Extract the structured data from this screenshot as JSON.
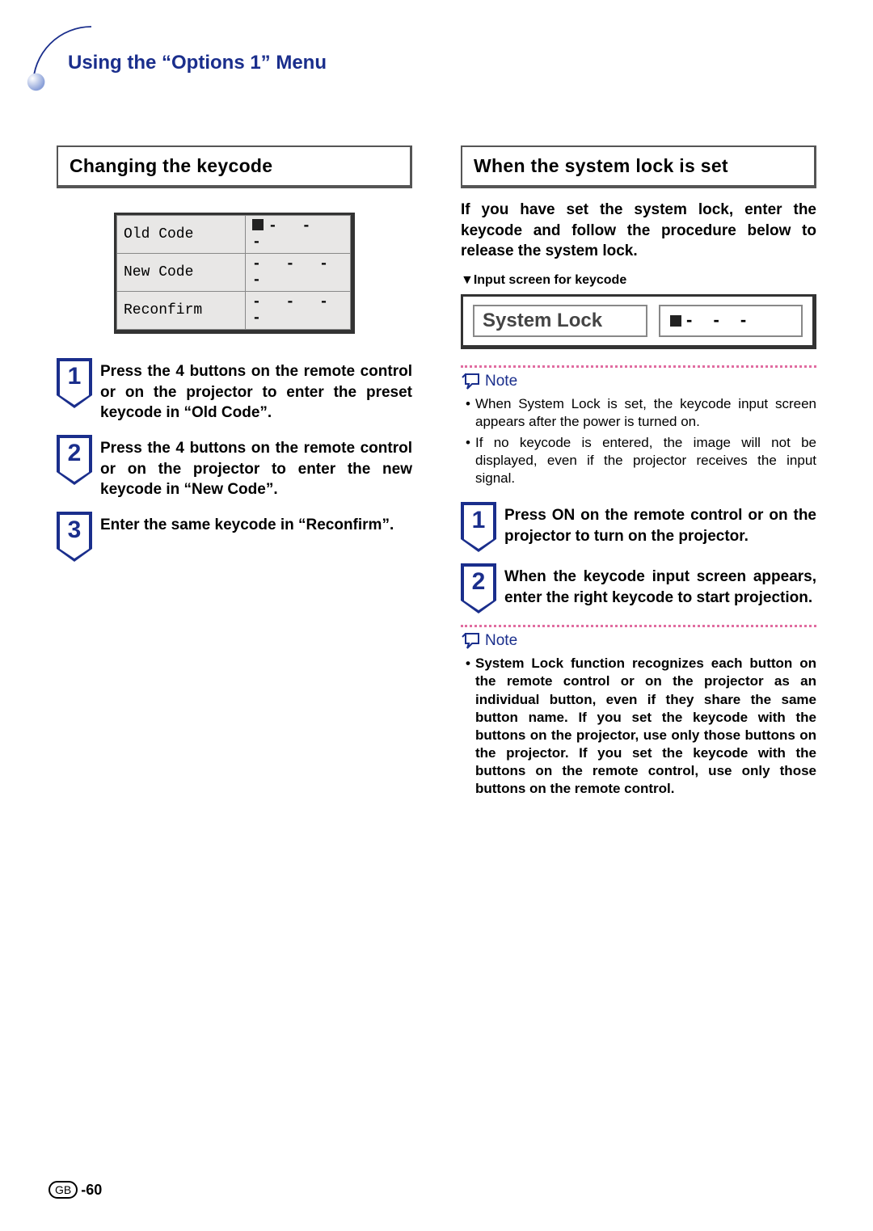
{
  "page_title": "Using the “Options 1” Menu",
  "left": {
    "heading": "Changing the keycode",
    "table": {
      "rows": [
        {
          "label": "Old Code",
          "has_cursor": true
        },
        {
          "label": "New Code",
          "has_cursor": false
        },
        {
          "label": "Reconfirm",
          "has_cursor": false
        }
      ],
      "dash": "- - -",
      "dash4": "- - - -"
    },
    "steps": [
      "Press the 4 buttons on the remote control or on the projector to enter the preset keycode in “Old Code”.",
      "Press the 4 buttons on the remote control or on the projector to enter the new keycode in “New Code”.",
      "Enter the same keycode in “Reconfirm”."
    ]
  },
  "right": {
    "heading": "When the system lock is set",
    "intro": "If you have set the system lock, enter the keycode and follow the procedure below to release the system lock.",
    "caption": "▼Input screen for keycode",
    "syslock_label": "System Lock",
    "dash": "- - -",
    "note_label": "Note",
    "notes1": [
      "When System Lock is set, the keycode input screen appears after the power is turned on.",
      "If no keycode is entered, the image will not be displayed, even if the projector receives the input signal."
    ],
    "steps_prefix": [
      "Press ",
      " on the remote control or on the projector to turn on the projector."
    ],
    "on_word": "ON",
    "step2": "When the keycode input screen appears, enter the right keycode to start projection.",
    "notes2": [
      "System Lock function recognizes each button on the remote control or on the projector as an individual button, even if they share the same button name. If you set the keycode with the buttons on the projector, use only those buttons on the projector. If you set the keycode with the buttons on the remote control, use only those buttons on the remote control."
    ]
  },
  "footer": {
    "region": "GB",
    "page": "-60"
  }
}
